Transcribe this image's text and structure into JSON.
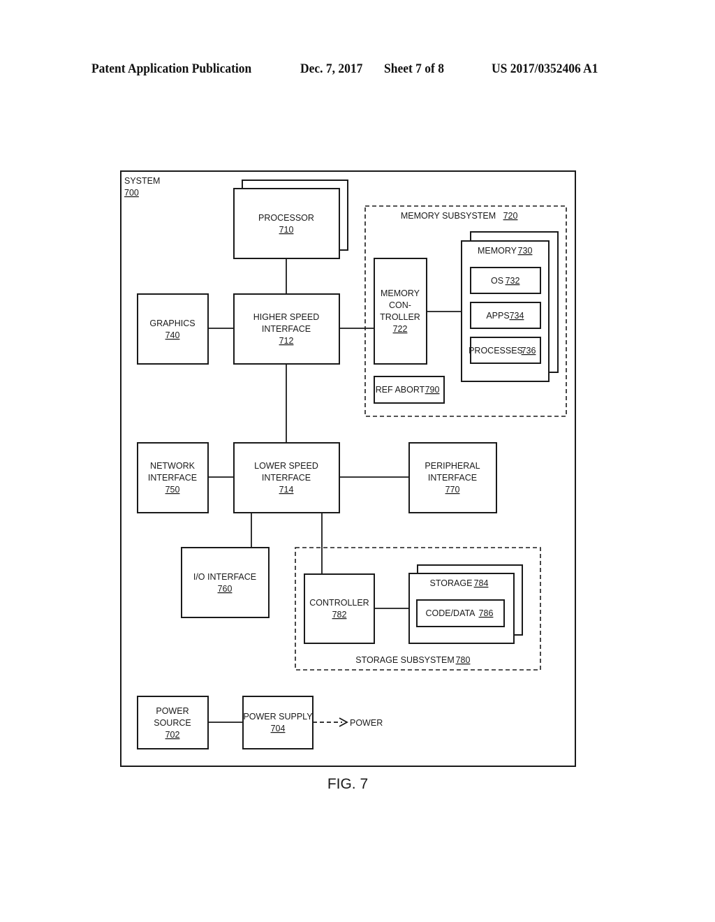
{
  "header": {
    "publication": "Patent Application Publication",
    "date": "Dec. 7, 2017",
    "sheet": "Sheet 7 of 8",
    "number": "US 2017/0352406 A1"
  },
  "figure": {
    "label": "FIG. 7"
  },
  "system": {
    "name": "SYSTEM",
    "ref": "700"
  },
  "blocks": {
    "processor": {
      "lines": [
        "PROCESSOR"
      ],
      "ref": "710"
    },
    "graphics": {
      "lines": [
        "GRAPHICS"
      ],
      "ref": "740"
    },
    "higher_speed": {
      "lines": [
        "HIGHER SPEED",
        "INTERFACE"
      ],
      "ref": "712"
    },
    "memory_subsystem": {
      "name": "MEMORY SUBSYSTEM",
      "ref": "720"
    },
    "memory_controller": {
      "lines": [
        "MEMORY",
        "CON-",
        "TROLLER"
      ],
      "ref": "722"
    },
    "memory": {
      "name": "MEMORY",
      "ref": "730"
    },
    "os": {
      "name": "OS",
      "ref": "732"
    },
    "apps": {
      "name": "APPS",
      "ref": "734"
    },
    "processes": {
      "name": "PROCESSES",
      "ref": "736"
    },
    "ref_abort": {
      "name": "REF ABORT",
      "ref": "790"
    },
    "network": {
      "lines": [
        "NETWORK",
        "INTERFACE"
      ],
      "ref": "750"
    },
    "lower_speed": {
      "lines": [
        "LOWER SPEED",
        "INTERFACE"
      ],
      "ref": "714"
    },
    "peripheral": {
      "lines": [
        "PERIPHERAL",
        "INTERFACE"
      ],
      "ref": "770"
    },
    "io": {
      "lines": [
        "I/O INTERFACE"
      ],
      "ref": "760"
    },
    "storage_subsystem": {
      "name": "STORAGE SUBSYSTEM",
      "ref": "780"
    },
    "controller": {
      "lines": [
        "CONTROLLER"
      ],
      "ref": "782"
    },
    "storage": {
      "name": "STORAGE",
      "ref": "784"
    },
    "code_data": {
      "name": "CODE/DATA",
      "ref": "786"
    },
    "power_source": {
      "lines": [
        "POWER",
        "SOURCE"
      ],
      "ref": "702"
    },
    "power_supply": {
      "lines": [
        "POWER SUPPLY"
      ],
      "ref": "704"
    },
    "power_output": {
      "label": "POWER"
    }
  }
}
